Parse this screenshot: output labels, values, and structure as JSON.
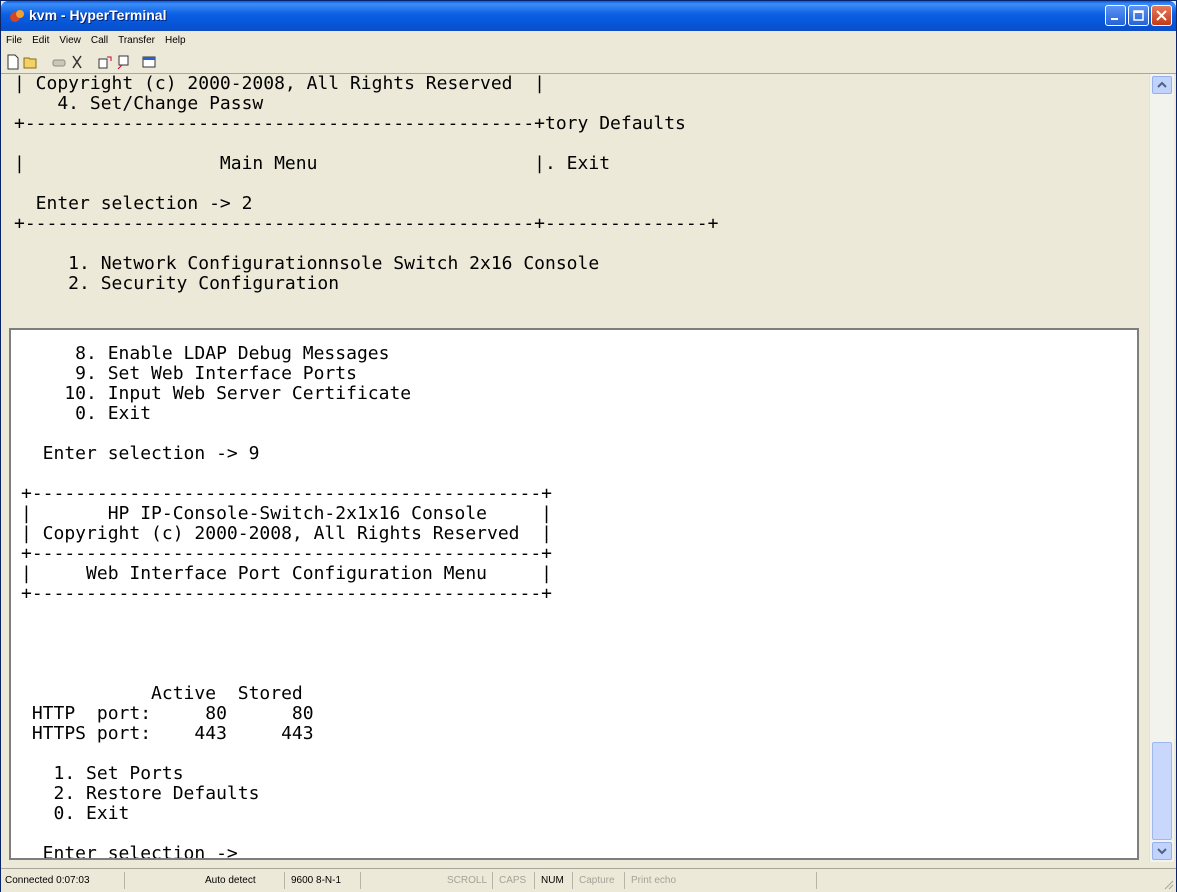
{
  "window": {
    "title": "kvm - HyperTerminal"
  },
  "menu": [
    "File",
    "Edit",
    "View",
    "Call",
    "Transfer",
    "Help"
  ],
  "toolbar": {
    "icons": [
      "new-icon",
      "open-icon",
      "call-icon",
      "disconnect-icon",
      "send-icon",
      "receive-icon",
      "properties-icon"
    ]
  },
  "terminal": {
    "background_lines": [
      "| Copyright (c) 2000-2008, All Rights Reserved  |",
      "    4. Set/Change Passw",
      "+-----------------------------------------------+tory Defaults",
      "",
      "|                  Main Menu                    |. Exit",
      "",
      "  Enter selection -> 2",
      "+-----------------------------------------------+---------------+",
      "",
      "     1. Network Configurationnsole Switch 2x16 Console",
      "     2. Security Configuration"
    ],
    "front_lines": [
      "     8. Enable LDAP Debug Messages",
      "     9. Set Web Interface Ports",
      "    10. Input Web Server Certificate",
      "     0. Exit",
      "",
      "  Enter selection -> 9",
      "",
      "+-----------------------------------------------+",
      "|       HP IP-Console-Switch-2x1x16 Console     |",
      "| Copyright (c) 2000-2008, All Rights Reserved  |",
      "+-----------------------------------------------+",
      "|     Web Interface Port Configuration Menu     |",
      "+-----------------------------------------------+",
      "",
      "",
      "",
      "",
      "            Active  Stored",
      " HTTP  port:     80      80",
      " HTTPS port:    443     443",
      "",
      "   1. Set Ports",
      "   2. Restore Defaults",
      "   0. Exit",
      "",
      "  Enter selection ->"
    ]
  },
  "status": {
    "connected": "Connected 0:07:03",
    "detect": "Auto detect",
    "settings": "9600 8-N-1",
    "scroll": "SCROLL",
    "caps": "CAPS",
    "num": "NUM",
    "capture": "Capture",
    "print_echo": "Print echo"
  }
}
